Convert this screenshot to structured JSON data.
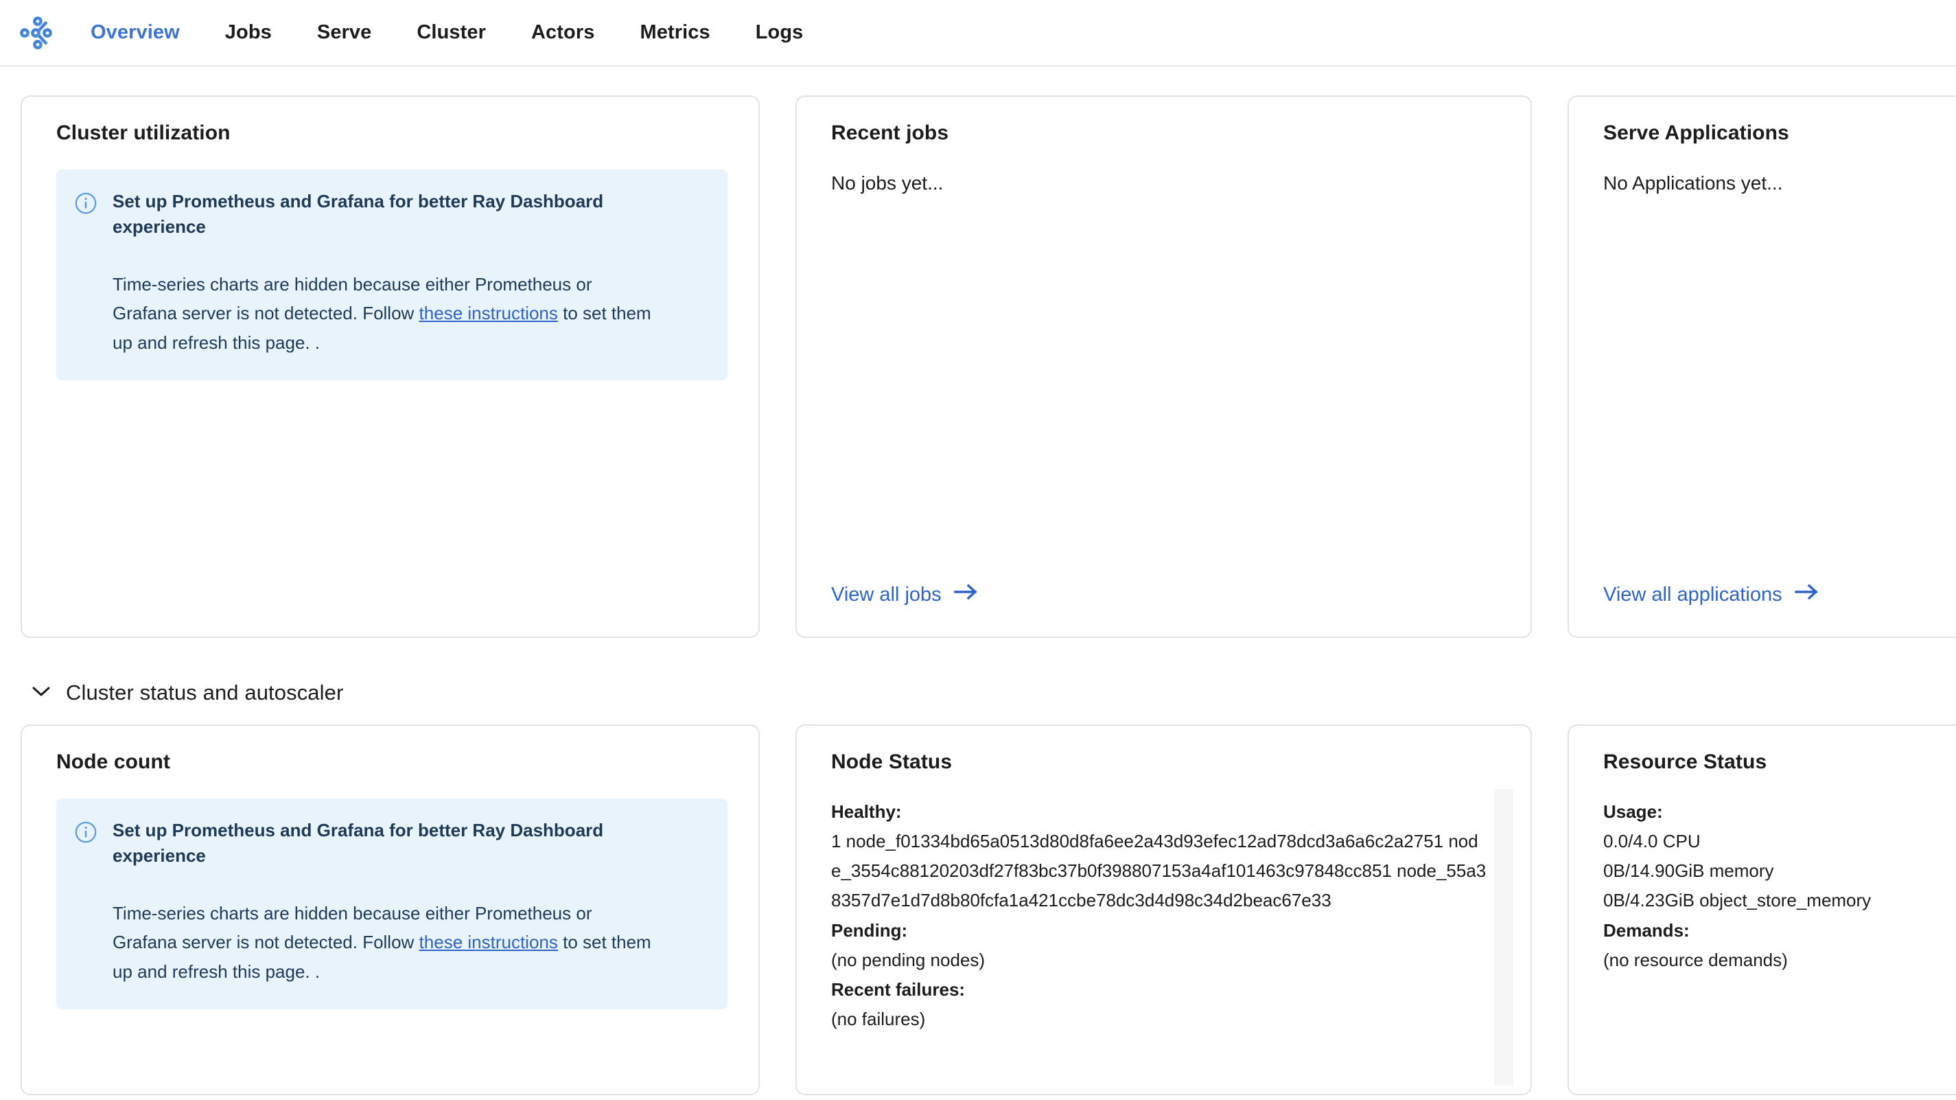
{
  "nav": {
    "logo_icon": "ray-logo-icon",
    "items": [
      {
        "label": "Overview",
        "active": true
      },
      {
        "label": "Jobs",
        "active": false
      },
      {
        "label": "Serve",
        "active": false
      },
      {
        "label": "Cluster",
        "active": false
      },
      {
        "label": "Actors",
        "active": false
      },
      {
        "label": "Metrics",
        "active": false
      },
      {
        "label": "Logs",
        "active": false
      }
    ]
  },
  "colors": {
    "accent": "#3b74d4",
    "link": "#2e63c8",
    "alert_bg": "#e8f3fc",
    "alert_text": "#1f3a57",
    "card_border": "#dfe4ea"
  },
  "alert": {
    "icon": "info-circle-icon",
    "title": "Set up Prometheus and Grafana for better Ray Dashboard experience",
    "text_before_link": "Time-series charts are hidden because either Prometheus or Grafana server is not detected. Follow ",
    "link_label": "these instructions",
    "text_after_link": " to set them up and refresh this page. ."
  },
  "cards": {
    "cluster_utilization": {
      "title": "Cluster utilization"
    },
    "recent_jobs": {
      "title": "Recent jobs",
      "empty": "No jobs yet...",
      "link_label": "View all jobs",
      "link_icon": "arrow-right-icon"
    },
    "serve_applications": {
      "title": "Serve Applications",
      "empty": "No Applications yet...",
      "link_label": "View all applications",
      "link_icon": "arrow-right-icon"
    },
    "node_count": {
      "title": "Node count"
    },
    "node_status": {
      "title": "Node Status",
      "healthy_label": "Healthy:",
      "healthy_values": [
        "1 node_f01334bd65a0513d80d8fa6ee2a43d93efec12ad78dcd3a6a6c2a2751 node_3554c88120203df27f83bc37b0f398807153a4af101463c97848cc851 node_55a38357d7e1d7d8b80fcfa1a421ccbe78dc3d4d98c34d2beac67e33"
      ],
      "pending_label": "Pending:",
      "pending_value": "(no pending nodes)",
      "failures_label": "Recent failures:",
      "failures_value": "(no failures)"
    },
    "resource_status": {
      "title": "Resource Status",
      "usage_label": "Usage:",
      "usage_values": [
        "0.0/4.0 CPU",
        "0B/14.90GiB memory",
        "0B/4.23GiB object_store_memory"
      ],
      "demands_label": "Demands:",
      "demands_value": "(no resource demands)"
    }
  },
  "sections": {
    "cluster_status": {
      "title": "Cluster status and autoscaler",
      "chevron_icon": "chevron-down-icon",
      "expanded": true
    }
  }
}
